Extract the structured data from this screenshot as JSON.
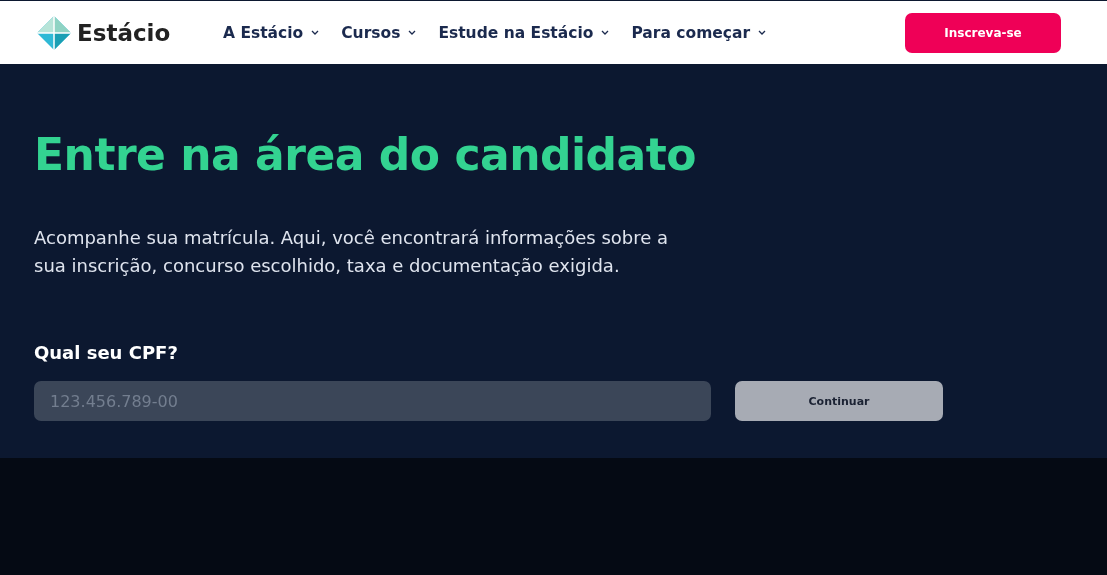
{
  "header": {
    "logo": "Estácio",
    "nav": [
      {
        "label": "A Estácio",
        "has_menu": true
      },
      {
        "label": "Cursos",
        "has_menu": true
      },
      {
        "label": "Estude na Estácio",
        "has_menu": true
      },
      {
        "label": "Para começar",
        "has_menu": true
      }
    ],
    "cta": "Inscreva-se"
  },
  "hero": {
    "title": "Entre na área do candidato",
    "description": "Acompanhe sua matrícula. Aqui, você encontrará informações sobre a sua inscrição, concurso escolhido, taxa e documentação exigida.",
    "field_label": "Qual seu CPF?",
    "field": {
      "placeholder": "123.456.789-00"
    },
    "submit": {
      "label": "Continuar",
      "disabled": true
    }
  }
}
